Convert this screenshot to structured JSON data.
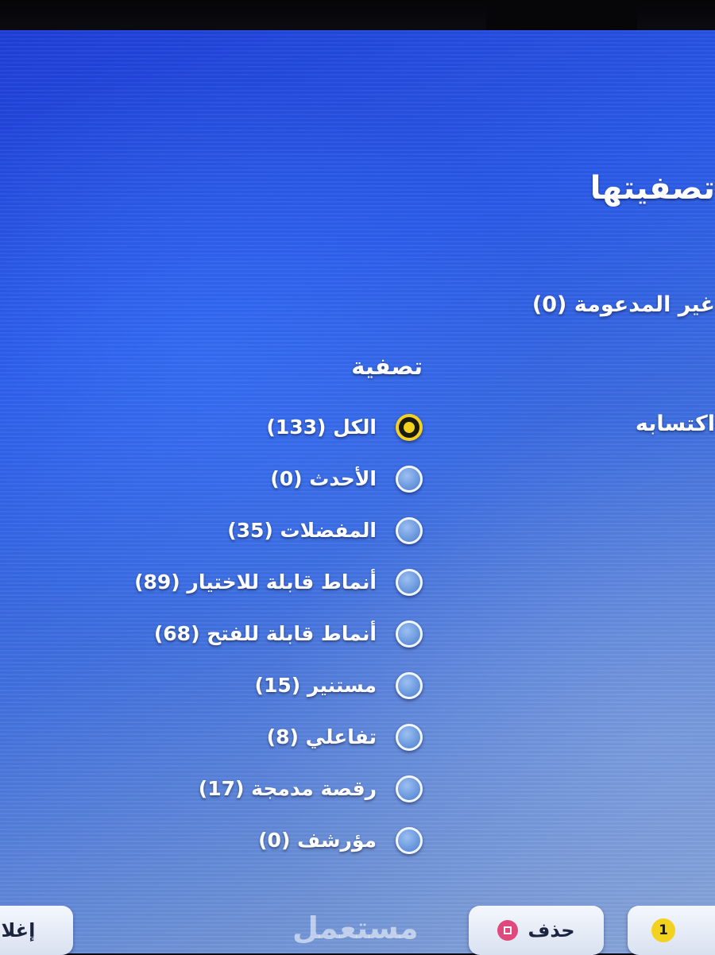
{
  "header": {
    "title": "تصفيتها"
  },
  "info": {
    "unsupported": "غير المدعومة (0)",
    "acquisition": "اكتسابه"
  },
  "filter": {
    "heading": "تصفية",
    "options": [
      {
        "label": "الكل (133)",
        "selected": true
      },
      {
        "label": "الأحدث (0)",
        "selected": false
      },
      {
        "label": "المفضلات (35)",
        "selected": false
      },
      {
        "label": "أنماط قابلة للاختيار (89)",
        "selected": false
      },
      {
        "label": "أنماط قابلة للفتح (68)",
        "selected": false
      },
      {
        "label": "مستنير (15)",
        "selected": false
      },
      {
        "label": "تفاعلي (8)",
        "selected": false
      },
      {
        "label": "رقصة مدمجة (17)",
        "selected": false
      },
      {
        "label": "مؤرشف (0)",
        "selected": false
      }
    ]
  },
  "footer": {
    "close_label": "إغلاق",
    "delete_label": "حذف",
    "delete_icon": "square-button-icon",
    "badge_count": "1"
  },
  "watermark": {
    "text": "مستعمل"
  },
  "colors": {
    "accent_selected": "#f3d21f",
    "background_blue": "#2a5ae8",
    "delete_icon_pink": "#e0497c"
  }
}
